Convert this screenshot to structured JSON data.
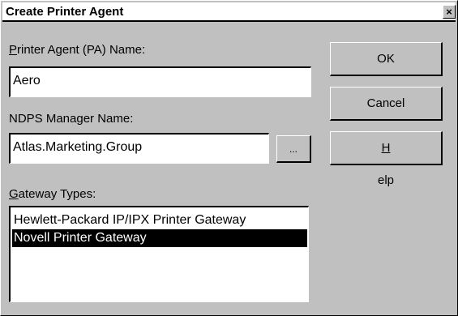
{
  "dialog": {
    "title": "Create Printer Agent",
    "close_label": "×"
  },
  "form": {
    "pa_name_label_mnemonic": "P",
    "pa_name_label_rest": "rinter Agent (PA) Name:",
    "pa_name_value": "Aero",
    "manager_label": "NDPS Manager Name:",
    "manager_value": "Atlas.Marketing.Group",
    "browse_label": "...",
    "gateway_label_mnemonic": "G",
    "gateway_label_rest": "ateway Types:"
  },
  "gateway_types": [
    "Hewlett-Packard IP/IPX Printer Gateway",
    "Novell Printer Gateway"
  ],
  "selected_gateway": "Novell Printer Gateway",
  "buttons": {
    "ok": "OK",
    "cancel": "Cancel",
    "help_mnemonic": "H",
    "help_rest": "elp"
  }
}
